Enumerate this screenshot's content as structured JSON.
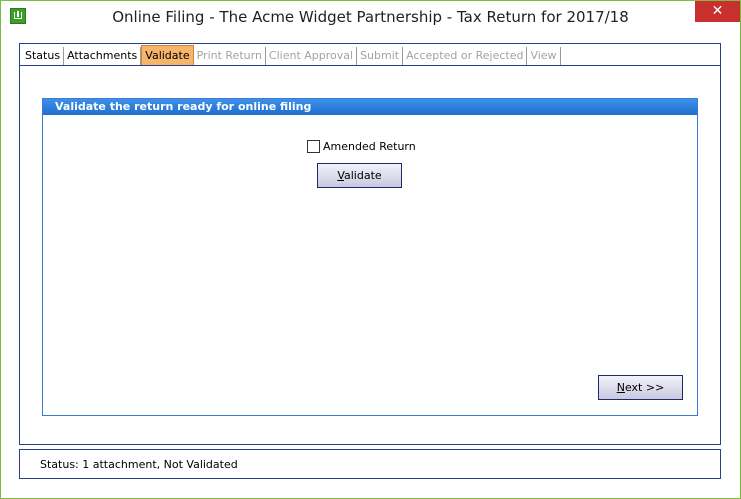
{
  "window": {
    "title": "Online Filing - The Acme Widget Partnership - Tax Return for 2017/18",
    "close_label": "✕"
  },
  "tabs": [
    {
      "label": "Status",
      "state": "enabled"
    },
    {
      "label": "Attachments",
      "state": "enabled"
    },
    {
      "label": "Validate",
      "state": "active"
    },
    {
      "label": "Print Return",
      "state": "disabled"
    },
    {
      "label": "Client Approval",
      "state": "disabled"
    },
    {
      "label": "Submit",
      "state": "disabled"
    },
    {
      "label": "Accepted or Rejected",
      "state": "disabled"
    },
    {
      "label": "View",
      "state": "disabled"
    }
  ],
  "panel": {
    "header": "Validate the return ready for online filing",
    "amended_label": "Amended Return",
    "amended_checked": false,
    "validate_first": "V",
    "validate_rest": "alidate",
    "next_first": "N",
    "next_rest": "ext >>"
  },
  "status": {
    "text": "Status: 1 attachment, Not Validated"
  },
  "colors": {
    "border": "#2a3f8a",
    "header_blue": "#1e6fd0",
    "active_tab": "#f7b56a",
    "close_red": "#c7302f",
    "frame_green": "#7cbc40"
  }
}
